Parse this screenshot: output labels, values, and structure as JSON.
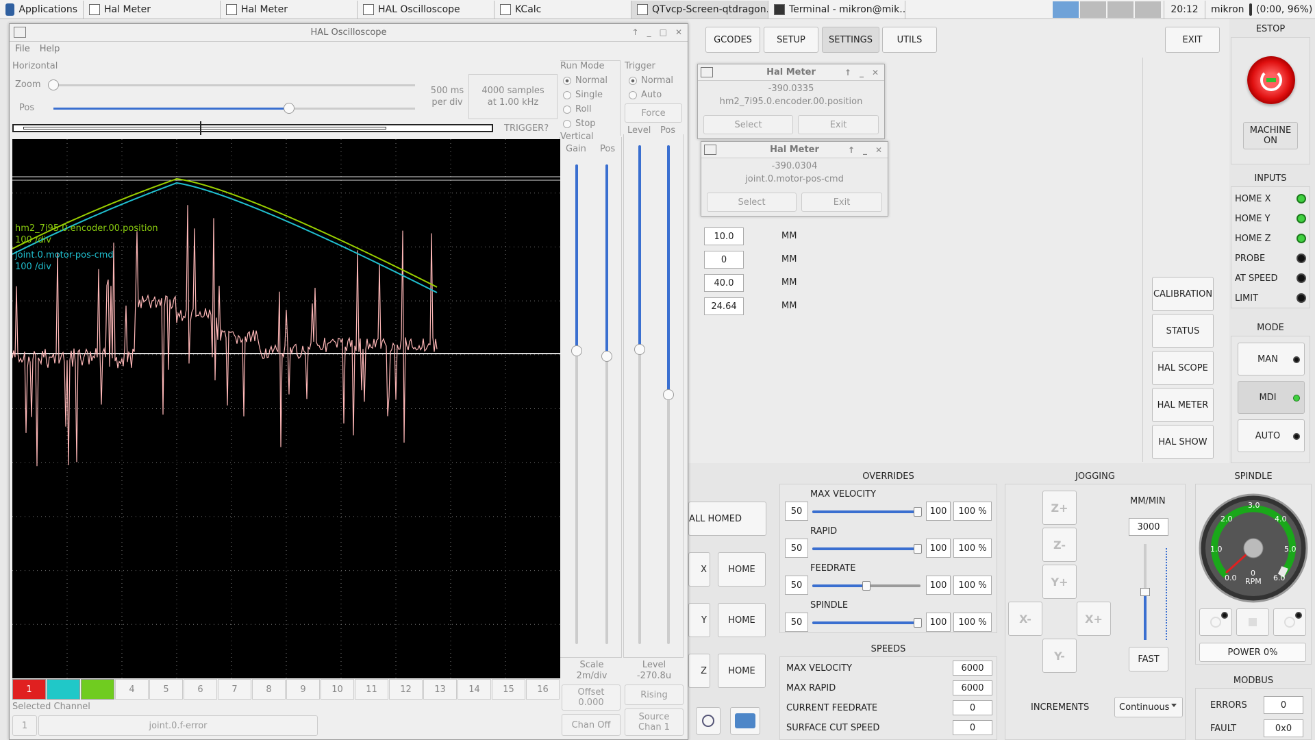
{
  "taskbar": {
    "items": [
      {
        "label": "Applications"
      },
      {
        "label": "Hal Meter"
      },
      {
        "label": "Hal Meter"
      },
      {
        "label": "HAL Oscilloscope"
      },
      {
        "label": "KCalc"
      },
      {
        "label": "QTvcp-Screen-qtdragon..."
      },
      {
        "label": "Terminal - mikron@mik..."
      }
    ],
    "clock": "20:12",
    "user": "mikron",
    "battery": "(0:00, 96%)"
  },
  "app": {
    "tabs": [
      "GCODES",
      "SETUP",
      "SETTINGS",
      "UTILS"
    ],
    "exit": "EXIT",
    "estop": {
      "title": "ESTOP",
      "machine_on": "MACHINE ON"
    },
    "inputs": {
      "title": "INPUTS",
      "items": [
        {
          "label": "HOME X",
          "on": true
        },
        {
          "label": "HOME Y",
          "on": true
        },
        {
          "label": "HOME Z",
          "on": true
        },
        {
          "label": "PROBE",
          "on": false
        },
        {
          "label": "AT SPEED",
          "on": false
        },
        {
          "label": "LIMIT",
          "on": false
        }
      ]
    },
    "mode": {
      "title": "MODE",
      "items": [
        "MAN",
        "MDI",
        "AUTO"
      ]
    },
    "side_buttons": [
      "CALIBRATION",
      "STATUS",
      "HAL SCOPE",
      "HAL METER",
      "HAL SHOW"
    ],
    "settings_values": [
      {
        "v": "10.0",
        "u": "MM"
      },
      {
        "v": "0",
        "u": "MM"
      },
      {
        "v": "40.0",
        "u": "MM"
      },
      {
        "v": "24.64",
        "u": "MM"
      }
    ],
    "homing": {
      "all": "ALL HOMED",
      "rows": [
        {
          "axis": "X",
          "btn": "HOME"
        },
        {
          "axis": "Y",
          "btn": "HOME"
        },
        {
          "axis": "Z",
          "btn": "HOME"
        }
      ]
    },
    "overrides": {
      "title": "OVERRIDES",
      "rows": [
        {
          "label": "MAX VELOCITY",
          "min": "50",
          "max": "100",
          "pct": "100 %",
          "frac": 1.0
        },
        {
          "label": "RAPID",
          "min": "50",
          "max": "100",
          "pct": "100 %",
          "frac": 1.0
        },
        {
          "label": "FEEDRATE",
          "min": "50",
          "max": "100",
          "pct": "100 %",
          "frac": 0.5
        },
        {
          "label": "SPINDLE",
          "min": "50",
          "max": "100",
          "pct": "100 %",
          "frac": 1.0
        }
      ]
    },
    "speeds": {
      "title": "SPEEDS",
      "rows": [
        {
          "label": "MAX VELOCITY",
          "v": "6000"
        },
        {
          "label": "MAX RAPID",
          "v": "6000"
        },
        {
          "label": "CURRENT FEEDRATE",
          "v": "0"
        },
        {
          "label": "SURFACE CUT SPEED",
          "v": "0"
        }
      ]
    },
    "jogging": {
      "title": "JOGGING",
      "unit": "MM/MIN",
      "rate": "3000",
      "fast": "FAST",
      "increments_label": "INCREMENTS",
      "increments": "Continuous",
      "keys": {
        "zp": "Z+",
        "zm": "Z-",
        "yp": "Y+",
        "ym": "Y-",
        "xm": "X-",
        "xp": "X+"
      }
    },
    "spindle": {
      "title": "SPINDLE",
      "power": "POWER 0%",
      "gauge": {
        "ticks": [
          "0.0",
          "1.0",
          "2.0",
          "3.0",
          "4.0",
          "5.0",
          "6.0"
        ],
        "center": "0",
        "unit": "RPM"
      }
    },
    "modbus": {
      "title": "MODBUS",
      "errors_label": "ERRORS",
      "errors": "0",
      "fault_label": "FAULT",
      "fault": "0x0"
    }
  },
  "meters": [
    {
      "title": "Hal Meter",
      "value": "-390.0335",
      "pin": "hm2_7i95.0.encoder.00.position",
      "select": "Select",
      "exit": "Exit"
    },
    {
      "title": "Hal Meter",
      "value": "-390.0304",
      "pin": "joint.0.motor-pos-cmd",
      "select": "Select",
      "exit": "Exit"
    }
  ],
  "scope": {
    "title": "HAL Oscilloscope",
    "menu": [
      "File",
      "Help"
    ],
    "horizontal": "Horizontal",
    "zoom": "Zoom",
    "pos": "Pos",
    "rate": "500 ms\nper div",
    "samples": "4000 samples\nat 1.00 kHz",
    "trigger_status": "TRIGGER?",
    "run_mode": {
      "title": "Run Mode",
      "items": [
        "Normal",
        "Single",
        "Roll",
        "Stop"
      ],
      "selected": "Normal"
    },
    "trigger": {
      "title": "Trigger",
      "items": [
        "Normal",
        "Auto"
      ],
      "selected": "Normal",
      "force": "Force",
      "level": "Level",
      "pos": "Pos"
    },
    "vertical": {
      "title": "Vertical",
      "gain": "Gain",
      "pos": "Pos"
    },
    "scale": "Scale\n2m/div",
    "offset": "Offset\n0.000",
    "chan_off": "Chan Off",
    "level_val": "Level\n-270.8u",
    "rising": "Rising",
    "source": "Source\nChan 1",
    "traces": [
      {
        "label": "hm2_7i95.0.encoder.00.position",
        "div": "100 /div",
        "color": "#9ad000"
      },
      {
        "label": "joint.0.motor-pos-cmd",
        "div": "100 /div",
        "color": "#20c0d0"
      }
    ],
    "channels": [
      "1",
      "2",
      "3",
      "4",
      "5",
      "6",
      "7",
      "8",
      "9",
      "10",
      "11",
      "12",
      "13",
      "14",
      "15",
      "16"
    ],
    "channel_colors": [
      "#e02020",
      "#20c8c8",
      "#70cc20"
    ],
    "selected_channel_label": "Selected Channel",
    "selected_channel": "1",
    "selected_pin": "joint.0.f-error"
  }
}
